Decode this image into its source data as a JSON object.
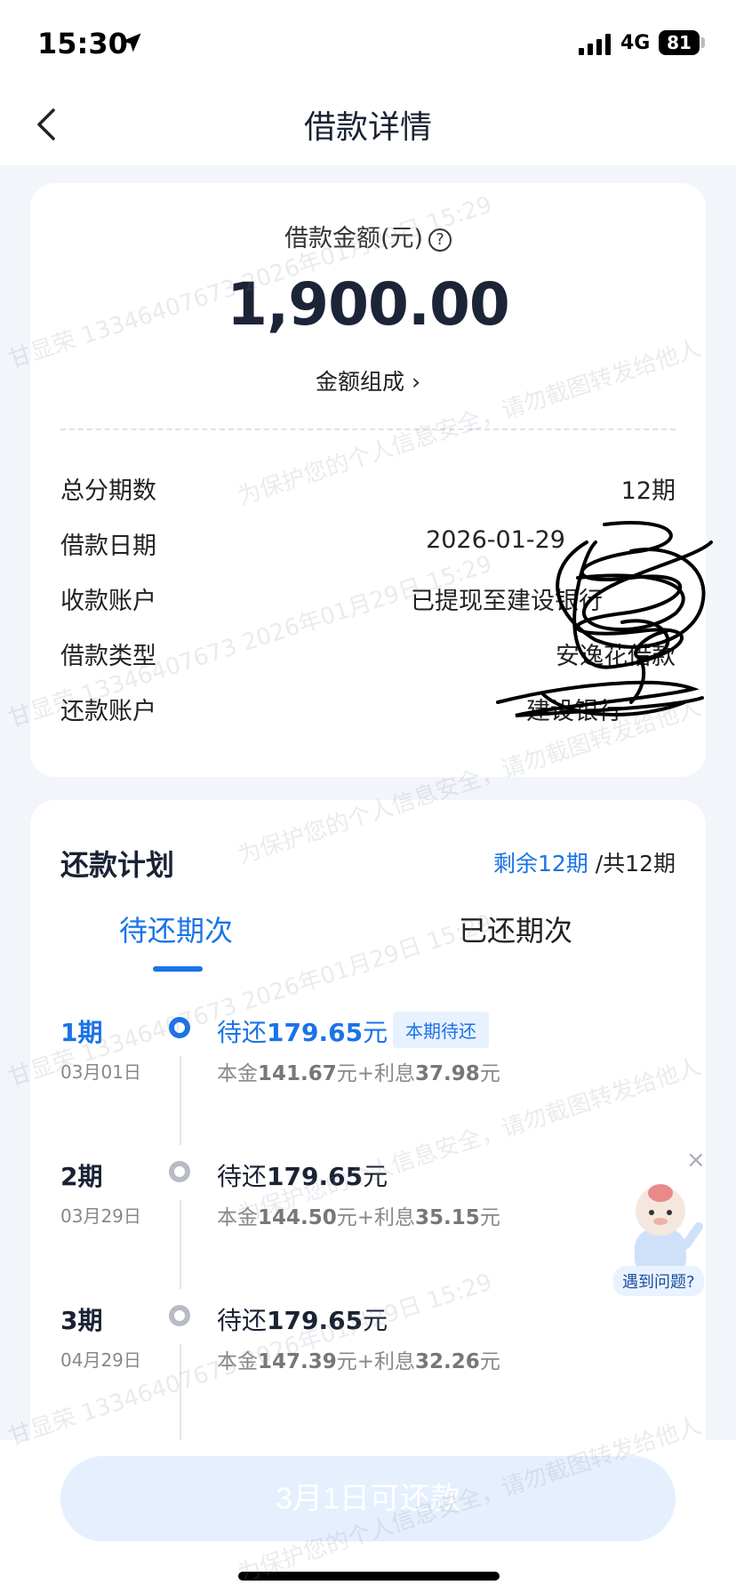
{
  "status_bar": {
    "time": "15:30",
    "network": "4G",
    "battery": "81"
  },
  "nav": {
    "title": "借款详情"
  },
  "loan": {
    "amount_label": "借款金额(元)",
    "help": "?",
    "amount": "1,900.00",
    "compose_link": "金额组成 ›",
    "rows": [
      {
        "key": "总分期数",
        "value": "12期"
      },
      {
        "key": "借款日期",
        "value": "2026-01-29"
      },
      {
        "key": "收款账户",
        "value": "已提现至建设银行"
      },
      {
        "key": "借款类型",
        "value": "安逸花借款"
      },
      {
        "key": "还款账户",
        "value": "建设银行"
      }
    ]
  },
  "plan": {
    "title": "还款计划",
    "remaining": "剩余12期",
    "total": "/共12期",
    "tabs": [
      "待还期次",
      "已还期次"
    ],
    "periods": [
      {
        "num": "1期",
        "date": "03月01日",
        "due_prefix": "待还",
        "due_amount": "179.65",
        "due_unit": "元",
        "badge": "本期待还",
        "principal_label": "本金",
        "principal": "141.67",
        "interest_label": "元+利息",
        "interest": "37.98",
        "tail": "元"
      },
      {
        "num": "2期",
        "date": "03月29日",
        "due_prefix": "待还",
        "due_amount": "179.65",
        "due_unit": "元",
        "principal_label": "本金",
        "principal": "144.50",
        "interest_label": "元+利息",
        "interest": "35.15",
        "tail": "元"
      },
      {
        "num": "3期",
        "date": "04月29日",
        "due_prefix": "待还",
        "due_amount": "179.65",
        "due_unit": "元",
        "principal_label": "本金",
        "principal": "147.39",
        "interest_label": "元+利息",
        "interest": "32.26",
        "tail": "元"
      }
    ]
  },
  "helper": {
    "label": "遇到问题?",
    "close": "×"
  },
  "bottom": {
    "button": "3月1日可还款"
  },
  "watermarks": [
    "甘显荣 13346407673 2026年01月29日 15:29",
    "为保护您的个人信息安全，请勿截图转发给他人"
  ],
  "colors": {
    "accent": "#1a73e8",
    "badge_bg": "#e8f1fe",
    "page_bg": "#f2f5f9"
  }
}
